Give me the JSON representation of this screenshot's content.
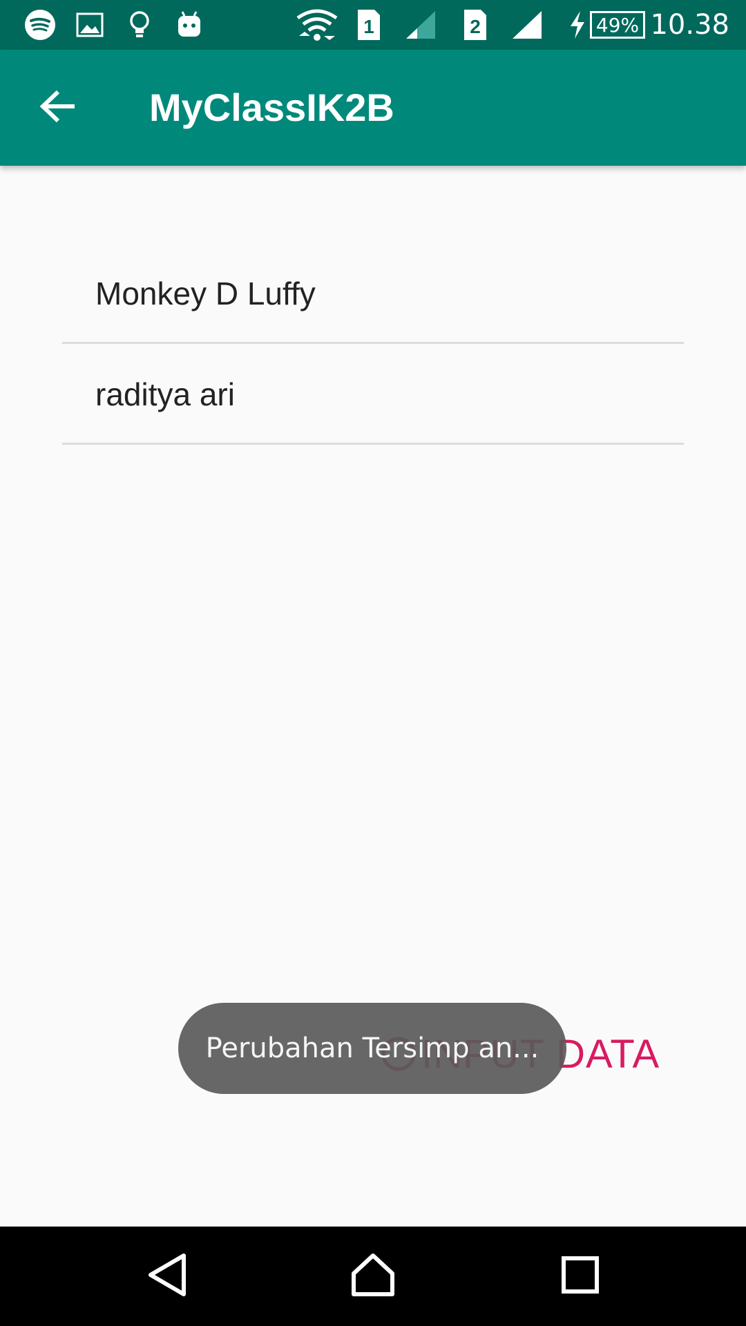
{
  "status_bar": {
    "time": "10.38",
    "battery": "49%",
    "sim1_label": "1",
    "sim2_label": "2",
    "icons": [
      "spotify-icon",
      "gallery-icon",
      "lightbulb-icon",
      "android-icon",
      "wifi-icon",
      "sim1-icon",
      "signal-icon",
      "sim2-icon",
      "signal-icon",
      "charging-icon",
      "battery-icon"
    ]
  },
  "app_bar": {
    "title": "MyClassIK2B",
    "back_icon": "arrow-left-icon"
  },
  "list": {
    "items": [
      {
        "label": "Monkey D Luffy"
      },
      {
        "label": "raditya ari"
      }
    ]
  },
  "input_button": {
    "label": "INPUT DATA",
    "icon": "circle-icon"
  },
  "toast": {
    "text": "Perubahan Tersimp an..."
  },
  "nav_bar": {
    "icons": [
      "back-triangle-icon",
      "home-icon",
      "recents-icon"
    ]
  },
  "colors": {
    "status_bar": "#00695c",
    "app_bar": "#00897b",
    "accent": "#d81b60",
    "background": "#fafafa",
    "toast": "#5a5a5a",
    "nav_bar": "#000000"
  }
}
